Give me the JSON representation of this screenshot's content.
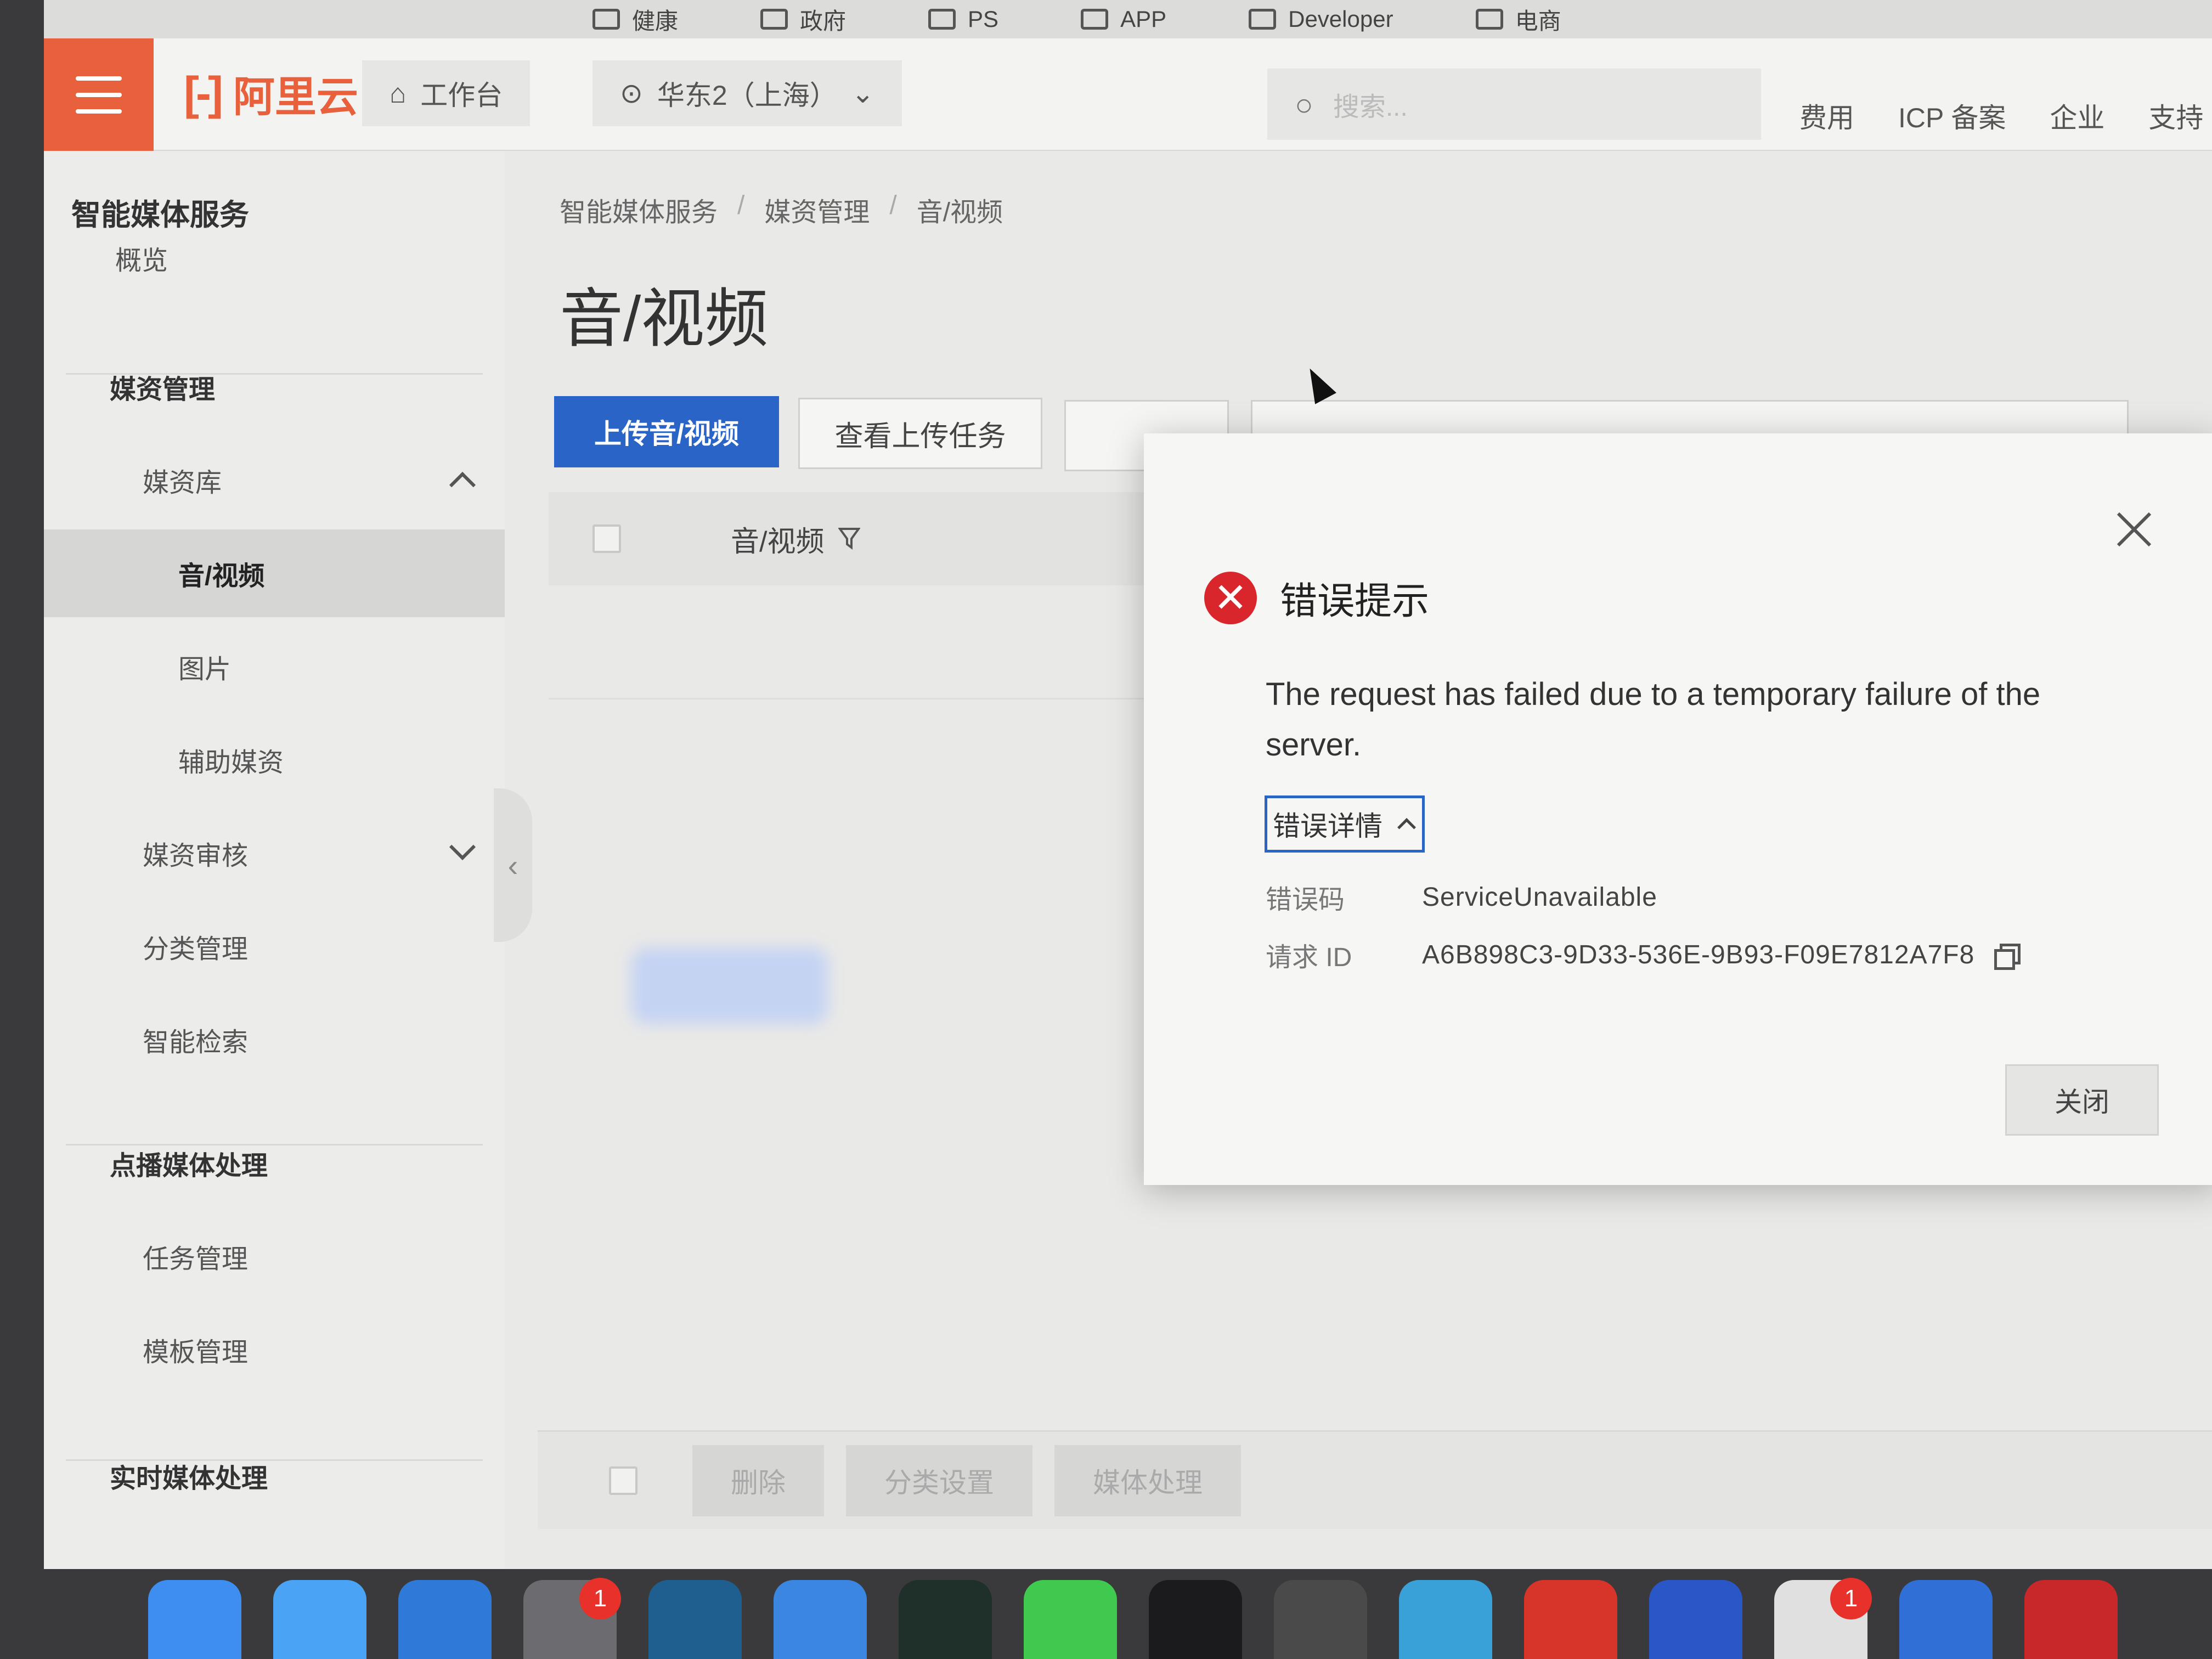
{
  "bookmarks": [
    {
      "label": "健康"
    },
    {
      "label": "政府"
    },
    {
      "label": "PS"
    },
    {
      "label": "APP"
    },
    {
      "label": "Developer"
    },
    {
      "label": "电商"
    }
  ],
  "topnav": {
    "logo_text": "阿里云",
    "workbench": "工作台",
    "region": "华东2（上海）",
    "search_placeholder": "搜索...",
    "links": [
      "费用",
      "ICP 备案",
      "企业",
      "支持"
    ]
  },
  "sidebar": {
    "title": "智能媒体服务",
    "items": [
      {
        "label": "概览",
        "type": "item"
      },
      {
        "label": "媒资管理",
        "type": "group"
      },
      {
        "label": "媒资库",
        "type": "sub",
        "chevron": "up"
      },
      {
        "label": "音/视频",
        "type": "leaf",
        "active": true
      },
      {
        "label": "图片",
        "type": "leaf"
      },
      {
        "label": "辅助媒资",
        "type": "leaf"
      },
      {
        "label": "媒资审核",
        "type": "sub",
        "chevron": "down"
      },
      {
        "label": "分类管理",
        "type": "sub"
      },
      {
        "label": "智能检索",
        "type": "sub"
      },
      {
        "label": "点播媒体处理",
        "type": "group"
      },
      {
        "label": "任务管理",
        "type": "sub"
      },
      {
        "label": "模板管理",
        "type": "sub"
      },
      {
        "label": "实时媒体处理",
        "type": "group"
      }
    ]
  },
  "main": {
    "breadcrumb": [
      "智能媒体服务",
      "媒资管理",
      "音/视频"
    ],
    "page_title": "音/视频",
    "upload_button": "上传音/视频",
    "tasks_button": "查看上传任务",
    "table": {
      "column_header": "音/视频"
    },
    "footer_buttons": [
      "删除",
      "分类设置",
      "媒体处理"
    ]
  },
  "modal": {
    "title": "错误提示",
    "message": "The request has failed due to a temporary failure of the server.",
    "details_label": "错误详情",
    "details": [
      {
        "key": "错误码",
        "value": "ServiceUnavailable"
      },
      {
        "key": "请求 ID",
        "value": "A6B898C3-9D33-536E-9B93-F09E7812A7F8"
      }
    ],
    "close_button": "关闭"
  },
  "dock": {
    "apps": [
      {
        "name": "finder",
        "color": "#3d8ef0"
      },
      {
        "name": "mail",
        "color": "#4aa3f5"
      },
      {
        "name": "xcode",
        "color": "#2f7ad8"
      },
      {
        "name": "settings",
        "color": "#6b6b70",
        "badge": "1"
      },
      {
        "name": "network-app",
        "color": "#1f5f8f"
      },
      {
        "name": "safari",
        "color": "#3a86e0"
      },
      {
        "name": "activity-monitor",
        "color": "#1f2f2a"
      },
      {
        "name": "messages",
        "color": "#3fc94f"
      },
      {
        "name": "terminal",
        "color": "#1b1b1d"
      },
      {
        "name": "archive",
        "color": "#4a4a4a"
      },
      {
        "name": "photos",
        "color": "#3aa0d8"
      },
      {
        "name": "chrome",
        "color": "#d8352a"
      },
      {
        "name": "editor",
        "color": "#2a57c8"
      },
      {
        "name": "toggle-app",
        "color": "#e0e0e0",
        "badge": "1"
      },
      {
        "name": "chat-app",
        "color": "#2f6fd6"
      },
      {
        "name": "red-app",
        "color": "#c8282a"
      }
    ]
  },
  "colors": {
    "accent_blue": "#2a64c6",
    "brand_orange": "#e8603c",
    "error_red": "#d9262c"
  }
}
